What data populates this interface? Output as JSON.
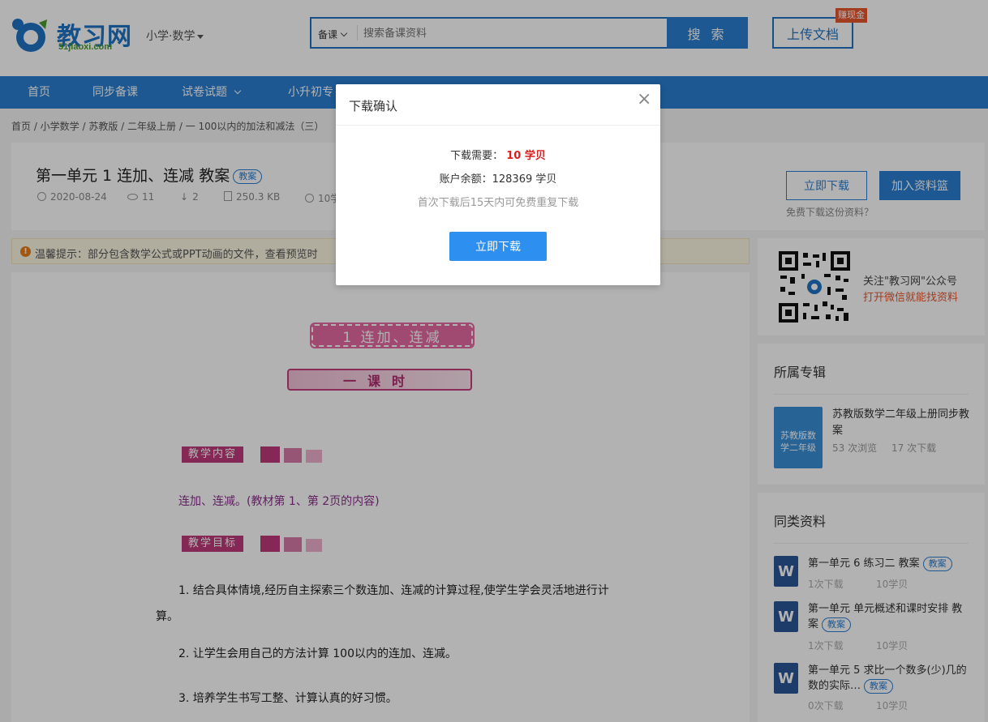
{
  "header": {
    "logo_text": "教习网",
    "logo_sub": "51jiaoxi.com",
    "subject": "小学·数学",
    "search_category": "备课",
    "search_placeholder": "搜索备课资料",
    "search_button": "搜 索",
    "upload_button": "上传文档",
    "earn_badge": "赚现金"
  },
  "nav": {
    "items": [
      "首页",
      "同步备课",
      "试卷试题",
      "小升初专"
    ]
  },
  "breadcrumb": "首页 / 小学数学 / 苏教版 / 二年级上册 / 一 100以内的加法和减法（三）",
  "doc": {
    "title": "第一单元 1 连加、连减 教案",
    "tag": "教案",
    "date": "2020-08-24",
    "views": "11",
    "downloads": "2",
    "size": "250.3 KB",
    "price": "10学",
    "download_button": "立即下载",
    "basket_button": "加入资料篮",
    "free_link": "免费下载这份资料？"
  },
  "tip": {
    "text": "温馨提示：部分包含数学公式或PPT动画的文件，查看预览时"
  },
  "content": {
    "banner1": "1 连加、连减",
    "banner2": "一课时",
    "section1": "教学内容",
    "section1_text": "连加、连减。(教材第 1、第 2页的内容)",
    "section2": "教学目标",
    "goal1_a": "1. 结合具体情境,经历自主探索三个数连加、连减的计算过程,使学生学会灵活地进行计",
    "goal1_b": "算。",
    "goal2": "2. 让学生会用自己的方法计算 100以内的连加、连减。",
    "goal3": "3. 培养学生书写工整、计算认真的好习惯。"
  },
  "sidebar": {
    "qr_line1": "关注\"教习网\"公众号",
    "qr_line2": "打开微信就能找资料",
    "album_title": "所属专辑",
    "album_cover_text": "苏教版数学二年级",
    "album_name": "苏教版数学二年级上册同步教案",
    "album_views": "53 次浏览",
    "album_downloads": "17 次下载",
    "similar_title": "同类资料",
    "similar": [
      {
        "title": "第一单元 6 练习二 教案",
        "tag": "教案",
        "downloads": "1次下载",
        "price": "10学贝"
      },
      {
        "title": "第一单元 单元概述和课时安排 教案",
        "tag": "教案",
        "downloads": "1次下载",
        "price": "10学贝"
      },
      {
        "title": "第一单元 5 求比一个数多(少)几的数的实际…",
        "tag": "教案",
        "downloads": "0次下载",
        "price": "10学贝"
      }
    ]
  },
  "modal": {
    "title": "下载确认",
    "close": "×",
    "need_label": "下载需要：",
    "need_value": "10 学贝",
    "balance": "账户余额：128369 学贝",
    "note": "首次下载后15天内可免费重复下载",
    "button": "立即下载"
  },
  "colors": {
    "primary": "#2a7fd2",
    "accent_red": "#d82020",
    "orange": "#e9562d",
    "magenta": "#c03a7c"
  }
}
